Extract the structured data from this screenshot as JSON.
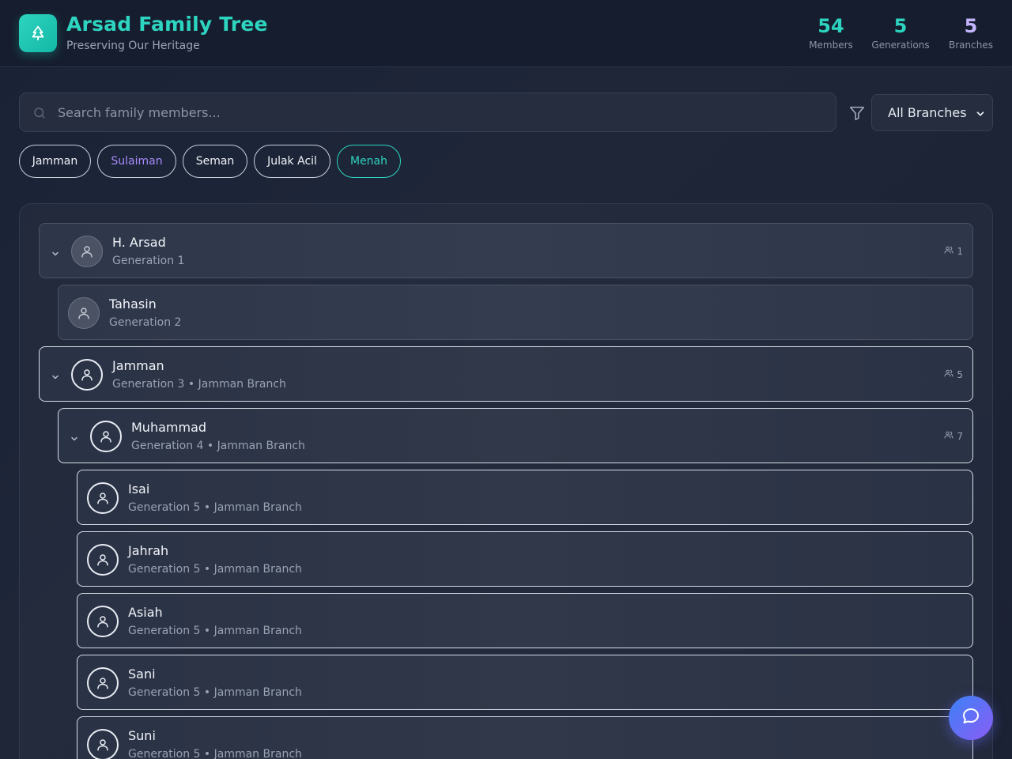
{
  "header": {
    "title": "Arsad Family Tree",
    "subtitle": "Preserving Our Heritage",
    "stats": [
      {
        "value": "54",
        "label": "Members"
      },
      {
        "value": "5",
        "label": "Generations"
      },
      {
        "value": "5",
        "label": "Branches"
      }
    ]
  },
  "search": {
    "placeholder": "Search family members...",
    "value": ""
  },
  "filter": {
    "selected": "All Branches"
  },
  "branches": [
    "Jamman",
    "Sulaiman",
    "Seman",
    "Julak Acil",
    "Menah"
  ],
  "tree": [
    {
      "name": "H. Arsad",
      "meta": "Generation 1",
      "count": "1",
      "expandable": true
    },
    {
      "name": "Tahasin",
      "meta": "Generation 2"
    },
    {
      "name": "Jamman",
      "meta": "Generation 3 • Jamman Branch",
      "count": "5",
      "expandable": true
    },
    {
      "name": "Muhammad",
      "meta": "Generation 4 • Jamman Branch",
      "count": "7",
      "expandable": true
    },
    {
      "name": "Isai",
      "meta": "Generation 5 • Jamman Branch"
    },
    {
      "name": "Jahrah",
      "meta": "Generation 5 • Jamman Branch"
    },
    {
      "name": "Asiah",
      "meta": "Generation 5 • Jamman Branch"
    },
    {
      "name": "Sani",
      "meta": "Generation 5 • Jamman Branch"
    },
    {
      "name": "Suni",
      "meta": "Generation 5 • Jamman Branch"
    }
  ],
  "colors": {
    "accent": "#2dd4bf",
    "purple": "#a78bfa",
    "background": "#1e2638"
  },
  "icons": {
    "logo": "tree-icon",
    "search": "search-icon",
    "filter": "filter-icon",
    "chat": "chat-icon",
    "member": "user-icon",
    "count": "users-icon"
  }
}
